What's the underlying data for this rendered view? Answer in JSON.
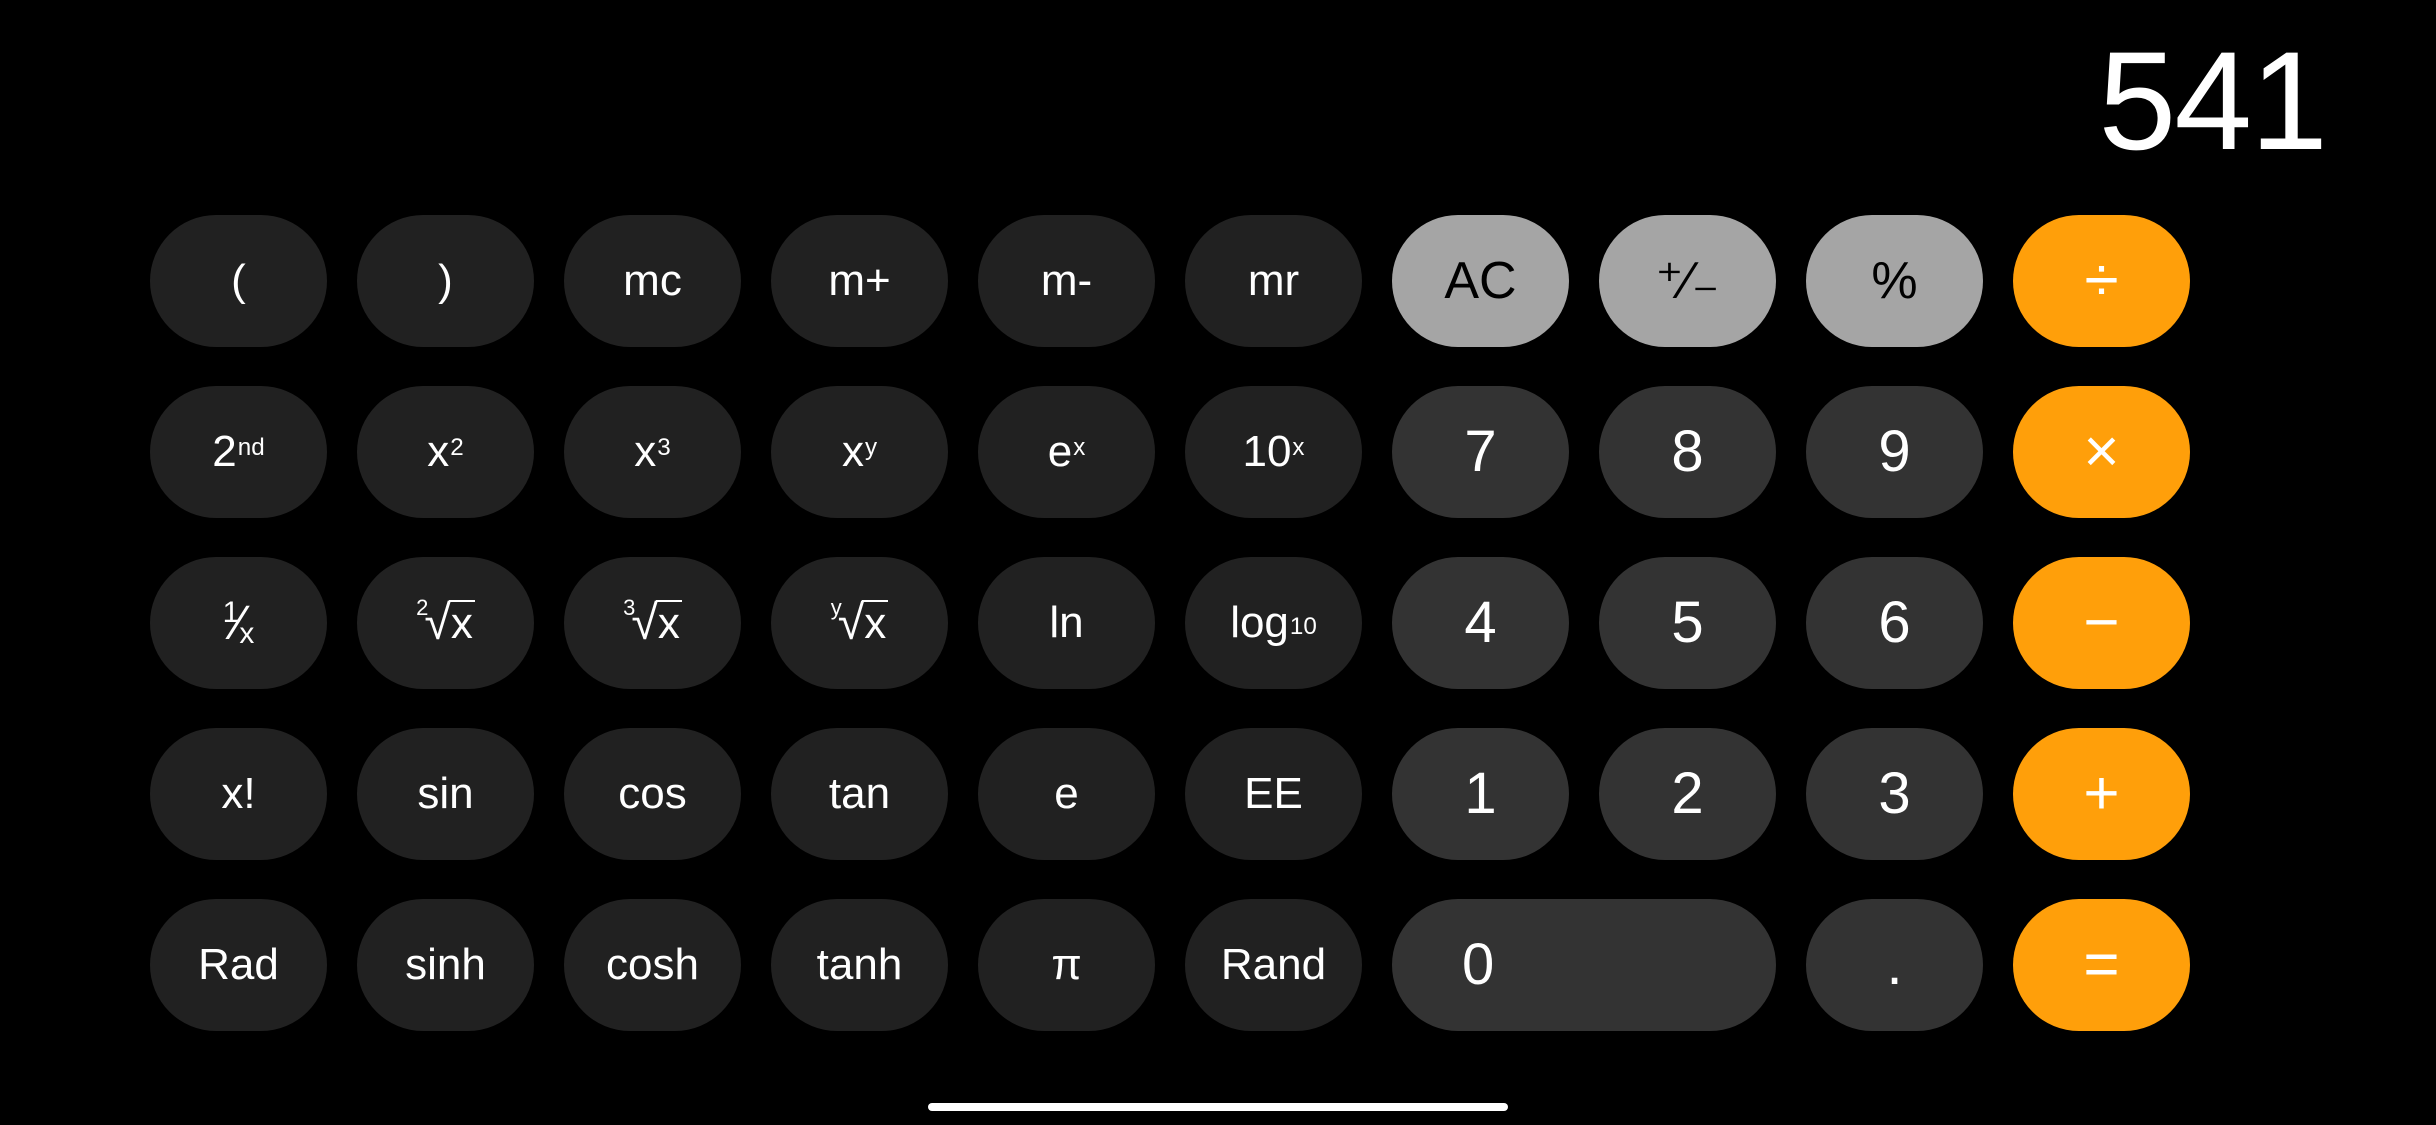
{
  "display": {
    "value": "541"
  },
  "row0": {
    "lparen": "(",
    "rparen": ")",
    "mc": "mc",
    "mplus": "m+",
    "mminus": "m-",
    "mr": "mr",
    "ac": "AC",
    "negate": "⁺∕₋",
    "percent": "%",
    "divide": "÷"
  },
  "row1": {
    "second_base": "2",
    "second_exp": "nd",
    "x2_base": "x",
    "x2_exp": "2",
    "x3_base": "x",
    "x3_exp": "3",
    "xy_base": "x",
    "xy_exp": "y",
    "ex_base": "e",
    "ex_exp": "x",
    "tenx_base": "10",
    "tenx_exp": "x",
    "d7": "7",
    "d8": "8",
    "d9": "9",
    "multiply": "×"
  },
  "row2": {
    "inv_n": "1",
    "inv_d": "x",
    "sqrt_idx": "2",
    "sqrt_arg": "x",
    "cbrt_idx": "3",
    "cbrt_arg": "x",
    "yroot_idx": "y",
    "yroot_arg": "x",
    "ln": "ln",
    "log_base": "log",
    "log_sub": "10",
    "d4": "4",
    "d5": "5",
    "d6": "6",
    "minus": "−"
  },
  "row3": {
    "fact": "x!",
    "sin": "sin",
    "cos": "cos",
    "tan": "tan",
    "e": "e",
    "ee": "EE",
    "d1": "1",
    "d2": "2",
    "d3": "3",
    "plus": "+"
  },
  "row4": {
    "rad": "Rad",
    "sinh": "sinh",
    "cosh": "cosh",
    "tanh": "tanh",
    "pi": "π",
    "rand": "Rand",
    "d0": "0",
    "dot": ".",
    "equals": "="
  }
}
